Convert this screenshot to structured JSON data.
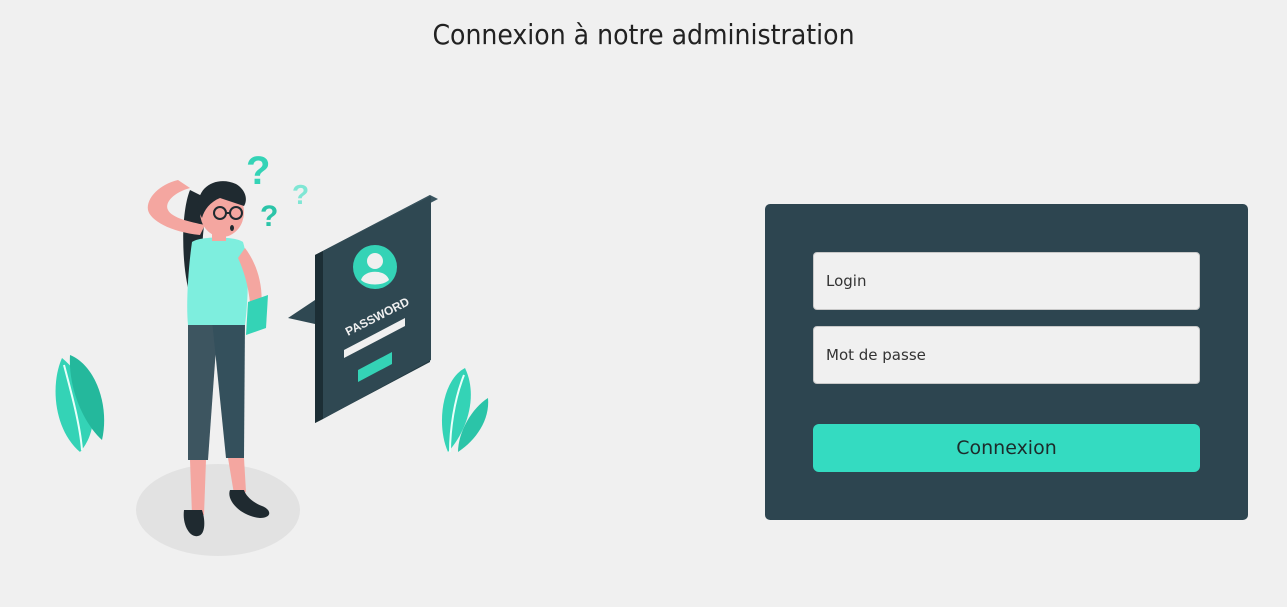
{
  "page": {
    "title": "Connexion à notre administration"
  },
  "illustration": {
    "badge_text": "PASSWORD"
  },
  "form": {
    "login_placeholder": "Login",
    "password_placeholder": "Mot de passe",
    "submit_label": "Connexion"
  },
  "colors": {
    "background": "#f0f0f0",
    "panel": "#2d4550",
    "accent": "#34dbc1"
  }
}
